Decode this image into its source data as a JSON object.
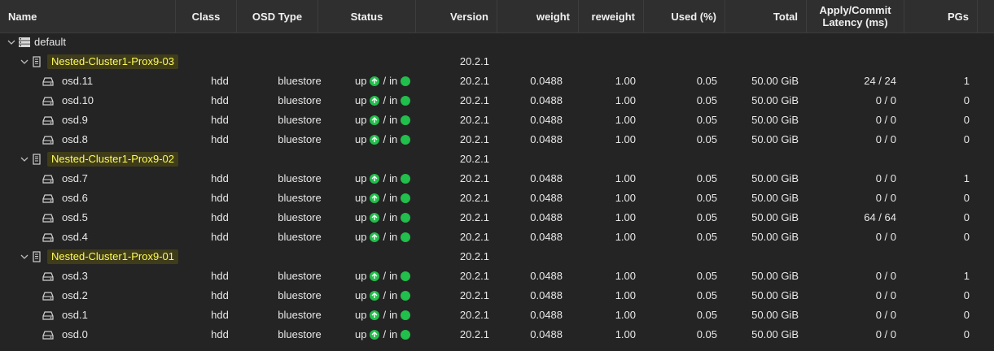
{
  "columns": {
    "name": "Name",
    "class": "Class",
    "osd_type": "OSD Type",
    "status": "Status",
    "version": "Version",
    "weight": "weight",
    "reweight": "reweight",
    "used": "Used (%)",
    "total": "Total",
    "latency": "Apply/Commit Latency (ms)",
    "pgs": "PGs"
  },
  "colors": {
    "highlight_text": "#fffb58",
    "status_green": "#21bf4b"
  },
  "root": {
    "name": "default",
    "icon": "server-rack-icon"
  },
  "rows": [
    {
      "kind": "host",
      "name": "Nested-Cluster1-Prox9-03",
      "version": "20.2.1"
    },
    {
      "kind": "osd",
      "name": "osd.11",
      "class": "hdd",
      "osd_type": "bluestore",
      "status_up": "up",
      "status_sep": "/",
      "status_in": "in",
      "version": "20.2.1",
      "weight": "0.0488",
      "reweight": "1.00",
      "used": "0.05",
      "total": "50.00 GiB",
      "latency": "24 / 24",
      "pgs": "1"
    },
    {
      "kind": "osd",
      "name": "osd.10",
      "class": "hdd",
      "osd_type": "bluestore",
      "status_up": "up",
      "status_sep": "/",
      "status_in": "in",
      "version": "20.2.1",
      "weight": "0.0488",
      "reweight": "1.00",
      "used": "0.05",
      "total": "50.00 GiB",
      "latency": "0 / 0",
      "pgs": "0"
    },
    {
      "kind": "osd",
      "name": "osd.9",
      "class": "hdd",
      "osd_type": "bluestore",
      "status_up": "up",
      "status_sep": "/",
      "status_in": "in",
      "version": "20.2.1",
      "weight": "0.0488",
      "reweight": "1.00",
      "used": "0.05",
      "total": "50.00 GiB",
      "latency": "0 / 0",
      "pgs": "0"
    },
    {
      "kind": "osd",
      "name": "osd.8",
      "class": "hdd",
      "osd_type": "bluestore",
      "status_up": "up",
      "status_sep": "/",
      "status_in": "in",
      "version": "20.2.1",
      "weight": "0.0488",
      "reweight": "1.00",
      "used": "0.05",
      "total": "50.00 GiB",
      "latency": "0 / 0",
      "pgs": "0"
    },
    {
      "kind": "host",
      "name": "Nested-Cluster1-Prox9-02",
      "version": "20.2.1"
    },
    {
      "kind": "osd",
      "name": "osd.7",
      "class": "hdd",
      "osd_type": "bluestore",
      "status_up": "up",
      "status_sep": "/",
      "status_in": "in",
      "version": "20.2.1",
      "weight": "0.0488",
      "reweight": "1.00",
      "used": "0.05",
      "total": "50.00 GiB",
      "latency": "0 / 0",
      "pgs": "1"
    },
    {
      "kind": "osd",
      "name": "osd.6",
      "class": "hdd",
      "osd_type": "bluestore",
      "status_up": "up",
      "status_sep": "/",
      "status_in": "in",
      "version": "20.2.1",
      "weight": "0.0488",
      "reweight": "1.00",
      "used": "0.05",
      "total": "50.00 GiB",
      "latency": "0 / 0",
      "pgs": "0"
    },
    {
      "kind": "osd",
      "name": "osd.5",
      "class": "hdd",
      "osd_type": "bluestore",
      "status_up": "up",
      "status_sep": "/",
      "status_in": "in",
      "version": "20.2.1",
      "weight": "0.0488",
      "reweight": "1.00",
      "used": "0.05",
      "total": "50.00 GiB",
      "latency": "64 / 64",
      "pgs": "0"
    },
    {
      "kind": "osd",
      "name": "osd.4",
      "class": "hdd",
      "osd_type": "bluestore",
      "status_up": "up",
      "status_sep": "/",
      "status_in": "in",
      "version": "20.2.1",
      "weight": "0.0488",
      "reweight": "1.00",
      "used": "0.05",
      "total": "50.00 GiB",
      "latency": "0 / 0",
      "pgs": "0"
    },
    {
      "kind": "host",
      "name": "Nested-Cluster1-Prox9-01",
      "version": "20.2.1"
    },
    {
      "kind": "osd",
      "name": "osd.3",
      "class": "hdd",
      "osd_type": "bluestore",
      "status_up": "up",
      "status_sep": "/",
      "status_in": "in",
      "version": "20.2.1",
      "weight": "0.0488",
      "reweight": "1.00",
      "used": "0.05",
      "total": "50.00 GiB",
      "latency": "0 / 0",
      "pgs": "1"
    },
    {
      "kind": "osd",
      "name": "osd.2",
      "class": "hdd",
      "osd_type": "bluestore",
      "status_up": "up",
      "status_sep": "/",
      "status_in": "in",
      "version": "20.2.1",
      "weight": "0.0488",
      "reweight": "1.00",
      "used": "0.05",
      "total": "50.00 GiB",
      "latency": "0 / 0",
      "pgs": "0"
    },
    {
      "kind": "osd",
      "name": "osd.1",
      "class": "hdd",
      "osd_type": "bluestore",
      "status_up": "up",
      "status_sep": "/",
      "status_in": "in",
      "version": "20.2.1",
      "weight": "0.0488",
      "reweight": "1.00",
      "used": "0.05",
      "total": "50.00 GiB",
      "latency": "0 / 0",
      "pgs": "0"
    },
    {
      "kind": "osd",
      "name": "osd.0",
      "class": "hdd",
      "osd_type": "bluestore",
      "status_up": "up",
      "status_sep": "/",
      "status_in": "in",
      "version": "20.2.1",
      "weight": "0.0488",
      "reweight": "1.00",
      "used": "0.05",
      "total": "50.00 GiB",
      "latency": "0 / 0",
      "pgs": "0"
    }
  ]
}
